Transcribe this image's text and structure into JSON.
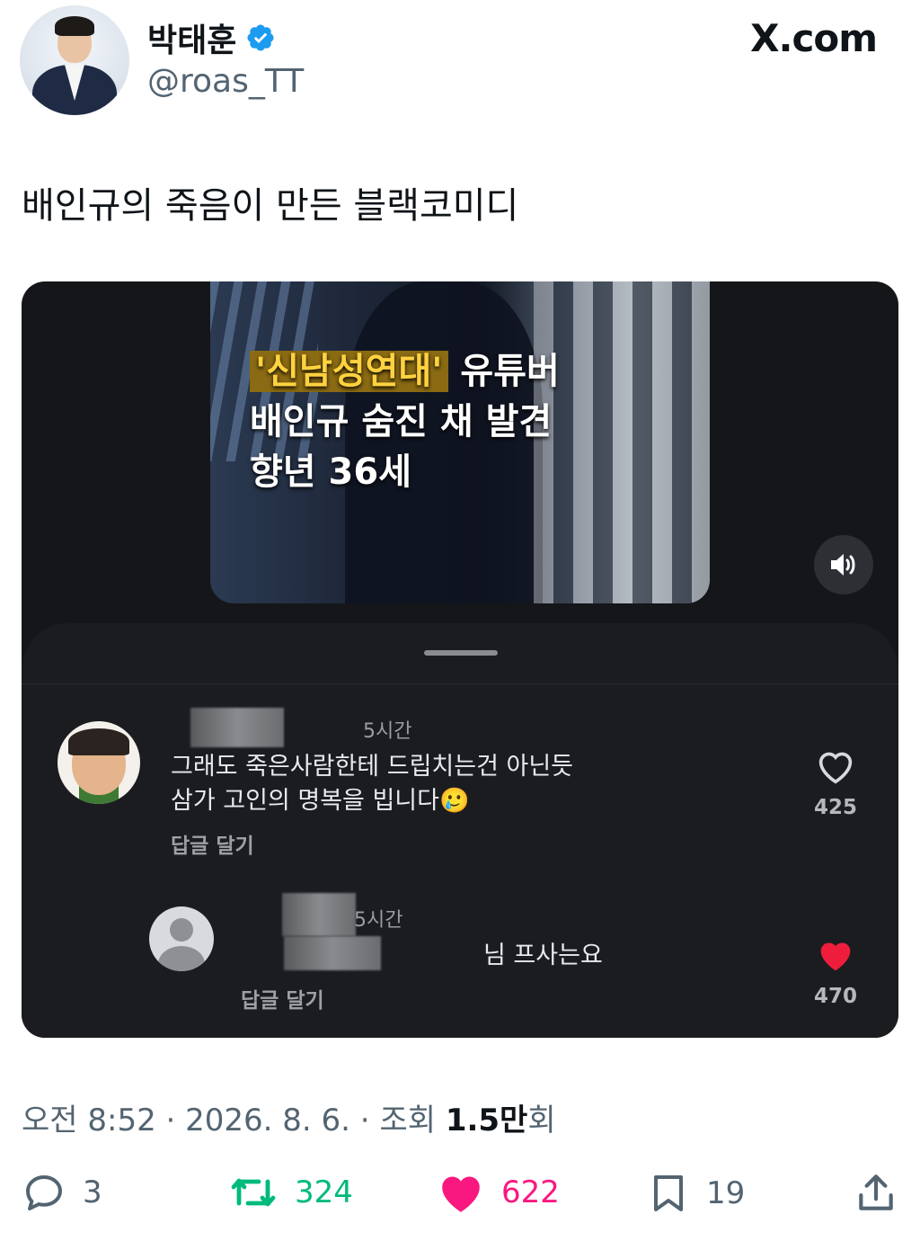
{
  "author": {
    "display_name": "박태훈",
    "handle": "@roas_TT",
    "verified": true
  },
  "site_label": "X.com",
  "tweet_text": "배인규의 죽음이 만든 블랙코미디",
  "media": {
    "headline": {
      "highlight": "'신남성연대'",
      "line1_rest": " 유튜버",
      "line2": "배인규 숨진 채 발견",
      "line3": "향년 36세"
    },
    "comments": [
      {
        "time": "5시간",
        "text_line1": "그래도 죽은사람한테  드립치는건 아닌듯",
        "text_line2": "삼가 고인의 명복을 빕니다🥲",
        "reply_label": "답글 달기",
        "likes": "425",
        "liked": false
      },
      {
        "time": "5시간",
        "text": "님 프사는요",
        "reply_label": "답글 달기",
        "likes": "470",
        "liked": true
      }
    ]
  },
  "meta": {
    "time": "오전 8:52",
    "date": "2026. 8. 6.",
    "views_label": "조회",
    "views_value": "1.5만",
    "views_suffix": "회"
  },
  "stats": {
    "replies": "3",
    "reposts": "324",
    "likes": "622",
    "bookmarks": "19"
  },
  "colors": {
    "verified": "#1d9bf0",
    "repost": "#00ba7c",
    "like": "#f91880",
    "secondary_text": "#536471",
    "heart_red": "#ee1d3c"
  }
}
